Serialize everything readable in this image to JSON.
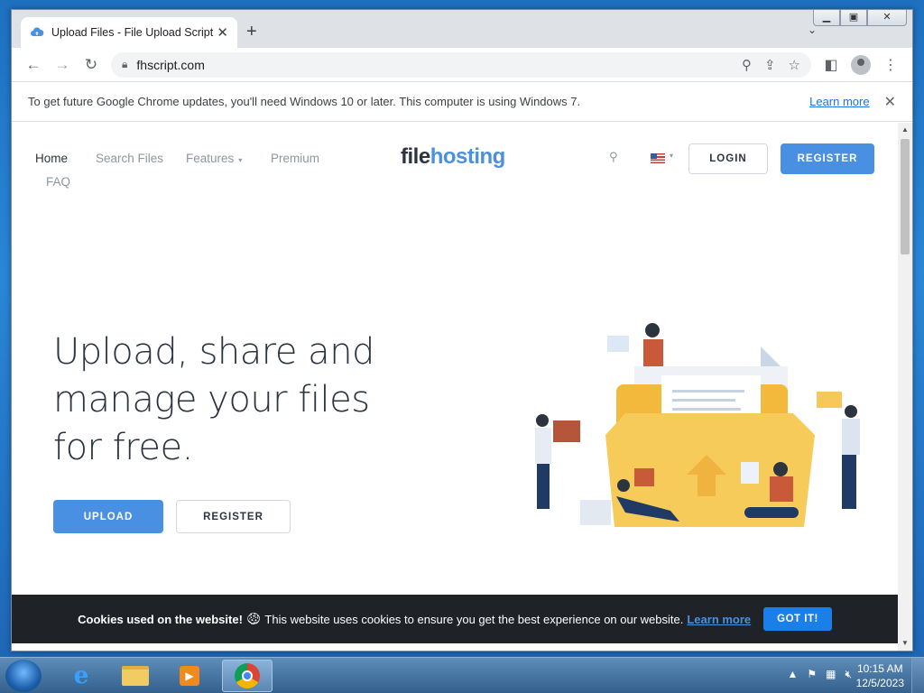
{
  "browser": {
    "tab_title": "Upload Files - File Upload Script",
    "url": "fhscript.com",
    "infobar_message": "To get future Google Chrome updates, you'll need Windows 10 or later. This computer is using Windows 7.",
    "infobar_link": "Learn more"
  },
  "site": {
    "nav": {
      "home": "Home",
      "search": "Search Files",
      "features": "Features",
      "premium": "Premium",
      "faq": "FAQ"
    },
    "logo_part1": "file",
    "logo_part2": "hosting",
    "login_label": "LOGIN",
    "register_label": "REGISTER",
    "hero_title": "Upload, share and manage your files for free.",
    "upload_button": "UPLOAD",
    "hero_register_button": "REGISTER",
    "cookie": {
      "bold": "Cookies used on the website!",
      "text": "This website uses cookies to ensure you get the best experience on our website.",
      "link": "Learn more",
      "button": "GOT IT!"
    },
    "colors": {
      "accent": "#4a90e2",
      "dark": "#2c3440",
      "illustration_yellow": "#f5c74e"
    }
  },
  "taskbar": {
    "time": "10:15 AM",
    "date": "12/5/2023"
  }
}
